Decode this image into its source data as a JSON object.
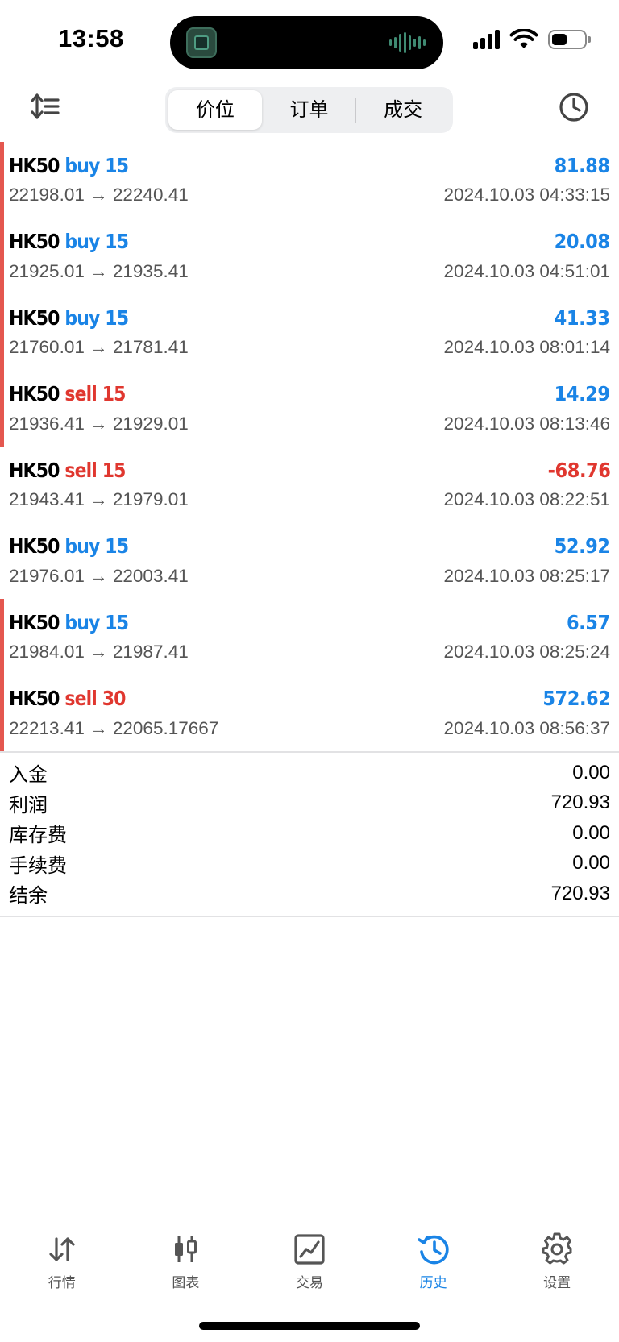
{
  "status_bar": {
    "time": "13:58"
  },
  "toolbar": {
    "segments": [
      "价位",
      "订单",
      "成交"
    ],
    "active_segment": 0
  },
  "deals": [
    {
      "symbol": "HK50",
      "side": "buy",
      "volume": "15",
      "profit": "81.88",
      "open_price": "22198.01",
      "close_price": "22240.41",
      "time": "2024.10.03 04:33:15",
      "marked": true
    },
    {
      "symbol": "HK50",
      "side": "buy",
      "volume": "15",
      "profit": "20.08",
      "open_price": "21925.01",
      "close_price": "21935.41",
      "time": "2024.10.03 04:51:01",
      "marked": true
    },
    {
      "symbol": "HK50",
      "side": "buy",
      "volume": "15",
      "profit": "41.33",
      "open_price": "21760.01",
      "close_price": "21781.41",
      "time": "2024.10.03 08:01:14",
      "marked": true
    },
    {
      "symbol": "HK50",
      "side": "sell",
      "volume": "15",
      "profit": "14.29",
      "open_price": "21936.41",
      "close_price": "21929.01",
      "time": "2024.10.03 08:13:46",
      "marked": true
    },
    {
      "symbol": "HK50",
      "side": "sell",
      "volume": "15",
      "profit": "-68.76",
      "open_price": "21943.41",
      "close_price": "21979.01",
      "time": "2024.10.03 08:22:51",
      "marked": false
    },
    {
      "symbol": "HK50",
      "side": "buy",
      "volume": "15",
      "profit": "52.92",
      "open_price": "21976.01",
      "close_price": "22003.41",
      "time": "2024.10.03 08:25:17",
      "marked": false
    },
    {
      "symbol": "HK50",
      "side": "buy",
      "volume": "15",
      "profit": "6.57",
      "open_price": "21984.01",
      "close_price": "21987.41",
      "time": "2024.10.03 08:25:24",
      "marked": true
    },
    {
      "symbol": "HK50",
      "side": "sell",
      "volume": "30",
      "profit": "572.62",
      "open_price": "22213.41",
      "close_price": "22065.17667",
      "time": "2024.10.03 08:56:37",
      "marked": true
    }
  ],
  "arrow": "→",
  "summary": [
    {
      "label": "入金",
      "value": "0.00"
    },
    {
      "label": "利润",
      "value": "720.93"
    },
    {
      "label": "库存费",
      "value": "0.00"
    },
    {
      "label": "手续费",
      "value": "0.00"
    },
    {
      "label": "结余",
      "value": "720.93"
    }
  ],
  "tabbar": {
    "tabs": [
      {
        "label": "行情",
        "icon": "quotes-arrows-icon"
      },
      {
        "label": "图表",
        "icon": "candlestick-chart-icon"
      },
      {
        "label": "交易",
        "icon": "trade-line-chart-icon"
      },
      {
        "label": "历史",
        "icon": "history-clock-icon"
      },
      {
        "label": "设置",
        "icon": "settings-gear-icon"
      }
    ],
    "active": 3
  },
  "colors": {
    "buy_blue": "#1a84e6",
    "sell_red": "#e0372f",
    "marker_red": "#e4574f",
    "secondary_text": "#555555",
    "segment_bg": "#eeeff1"
  }
}
